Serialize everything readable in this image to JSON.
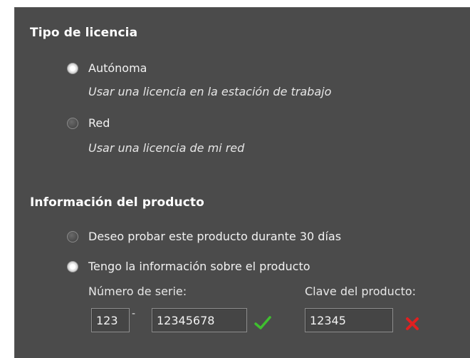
{
  "license": {
    "heading": "Tipo de licencia",
    "options": [
      {
        "label": "Autónoma",
        "description": "Usar una licencia en la estación de trabajo",
        "checked": true
      },
      {
        "label": "Red",
        "description": "Usar una licencia de mi red",
        "checked": false
      }
    ]
  },
  "product": {
    "heading": "Información del producto",
    "options": [
      {
        "label": "Deseo probar este producto durante 30 días",
        "checked": false
      },
      {
        "label": "Tengo la información sobre el producto",
        "checked": true
      }
    ],
    "serial_label": "Número de serie:",
    "serial_prefix": "123",
    "serial_separator": "-",
    "serial_number": "12345678",
    "serial_status_icon": "check-icon",
    "key_label": "Clave del producto:",
    "product_key": "12345",
    "key_status_icon": "error-x-icon"
  },
  "colors": {
    "panel_bg": "#4b4b4b",
    "valid": "#3fbf2f",
    "invalid": "#e02020"
  }
}
